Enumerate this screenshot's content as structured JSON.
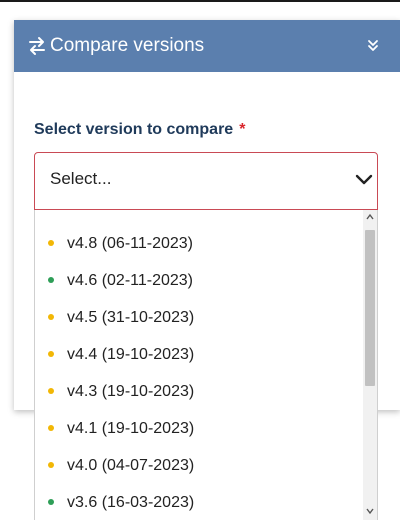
{
  "panel": {
    "title": "Compare versions",
    "header_color": "#5b7fae",
    "icon": "swap-arrows-icon",
    "collapse_icon": "double-chevron-down-icon"
  },
  "form": {
    "label": "Select version to compare",
    "required_marker": "*",
    "select": {
      "value": "Select...",
      "icon": "chevron-down-icon"
    }
  },
  "versions": [
    {
      "label": "v4.8 (06-11-2023)",
      "status_color": "#f2b705"
    },
    {
      "label": "v4.6 (02-11-2023)",
      "status_color": "#2e9e57"
    },
    {
      "label": "v4.5 (31-10-2023)",
      "status_color": "#f2b705"
    },
    {
      "label": "v4.4 (19-10-2023)",
      "status_color": "#f2b705"
    },
    {
      "label": "v4.3 (19-10-2023)",
      "status_color": "#f2b705"
    },
    {
      "label": "v4.1 (19-10-2023)",
      "status_color": "#f2b705"
    },
    {
      "label": "v4.0 (04-07-2023)",
      "status_color": "#f2b705"
    },
    {
      "label": "v3.6 (16-03-2023)",
      "status_color": "#2e9e57"
    }
  ]
}
